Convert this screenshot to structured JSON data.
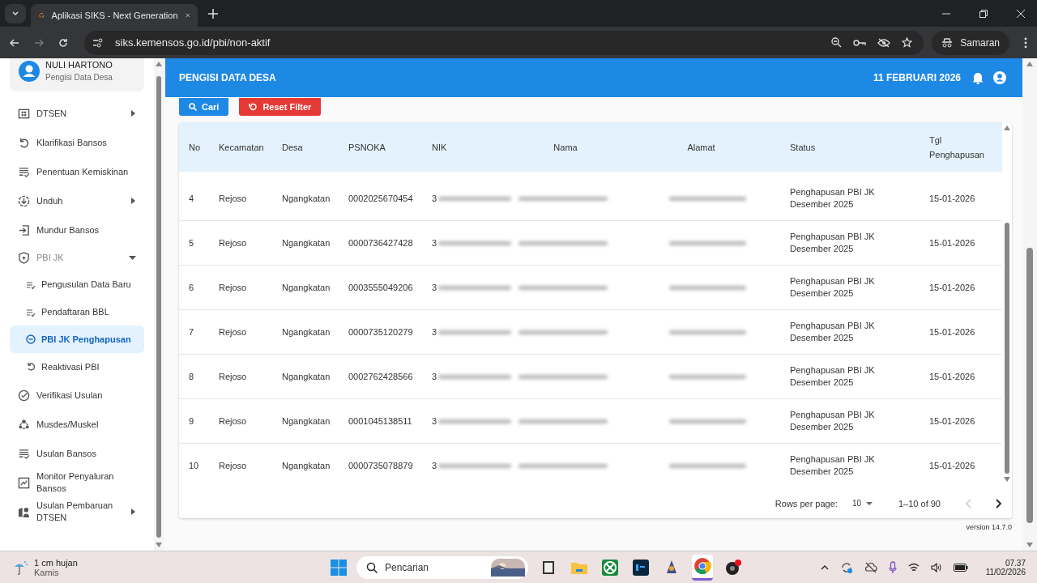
{
  "browser": {
    "tab_title": "Aplikasi SIKS - Next Generation",
    "url": "siks.kemensos.go.id/pbi/non-aktif",
    "profile_label": "Samaran"
  },
  "header": {
    "title": "PENGISI DATA DESA",
    "date": "11 FEBRUARI 2026"
  },
  "user": {
    "name": "NULI HARTONO",
    "role": "Pengisi Data Desa"
  },
  "sidebar": {
    "items": [
      {
        "label": "DTSEN",
        "expanded": false,
        "selected": false
      },
      {
        "label": "Klarifikasi Bansos",
        "selected": false
      },
      {
        "label": "Penentuan Kemiskinan",
        "selected": false
      },
      {
        "label": "Unduh",
        "expanded": false,
        "selected": false
      },
      {
        "label": "Mundur Bansos",
        "selected": false
      },
      {
        "label": "PBI JK",
        "expanded": true,
        "selected": false,
        "children": [
          {
            "label": "Pengusulan Data Baru",
            "selected": false
          },
          {
            "label": "Pendaftaran BBL",
            "selected": false
          },
          {
            "label": "PBI JK Penghapusan",
            "selected": true
          },
          {
            "label": "Reaktivasi PBI",
            "selected": false
          }
        ]
      },
      {
        "label": "Verifikasi Usulan",
        "selected": false
      },
      {
        "label": "Musdes/Muskel",
        "selected": false
      },
      {
        "label": "Usulan Bansos",
        "selected": false
      },
      {
        "label": "Monitor Penyaluran Bansos",
        "selected": false
      },
      {
        "label": "Usulan Pembaruan DTSEN",
        "expanded": false,
        "selected": false
      }
    ]
  },
  "filter_buttons": [
    {
      "label": "Cari",
      "kind": "search"
    },
    {
      "label": "Reset Filter",
      "kind": "reset"
    }
  ],
  "table": {
    "columns": [
      "No",
      "Kecamatan",
      "Desa",
      "PSNOKA",
      "NIK",
      "Nama",
      "Alamat",
      "Status",
      "Tgl Penghapusan"
    ],
    "rows": [
      {
        "no": "4",
        "kecamatan": "Rejoso",
        "desa": "Ngangkatan",
        "psnoka": "0002025670454",
        "nik": "3",
        "status": "Penghapusan PBI JK Desember 2025",
        "tgl": "15-01-2026"
      },
      {
        "no": "5",
        "kecamatan": "Rejoso",
        "desa": "Ngangkatan",
        "psnoka": "0000736427428",
        "nik": "3",
        "status": "Penghapusan PBI JK Desember 2025",
        "tgl": "15-01-2026"
      },
      {
        "no": "6",
        "kecamatan": "Rejoso",
        "desa": "Ngangkatan",
        "psnoka": "0003555049206",
        "nik": "3",
        "status": "Penghapusan PBI JK Desember 2025",
        "tgl": "15-01-2026"
      },
      {
        "no": "7",
        "kecamatan": "Rejoso",
        "desa": "Ngangkatan",
        "psnoka": "0000735120279",
        "nik": "3",
        "status": "Penghapusan PBI JK Desember 2025",
        "tgl": "15-01-2026"
      },
      {
        "no": "8",
        "kecamatan": "Rejoso",
        "desa": "Ngangkatan",
        "psnoka": "0002762428566",
        "nik": "3",
        "status": "Penghapusan PBI JK Desember 2025",
        "tgl": "15-01-2026"
      },
      {
        "no": "9",
        "kecamatan": "Rejoso",
        "desa": "Ngangkatan",
        "psnoka": "0001045138511",
        "nik": "3",
        "status": "Penghapusan PBI JK Desember 2025",
        "tgl": "15-01-2026"
      },
      {
        "no": "10",
        "kecamatan": "Rejoso",
        "desa": "Ngangkatan",
        "psnoka": "0000735078879",
        "nik": "3",
        "status": "Penghapusan PBI JK Desember 2025",
        "tgl": "15-01-2026"
      }
    ]
  },
  "pagination": {
    "rows_label": "Rows per page:",
    "rows_value": "10",
    "range": "1–10 of 90",
    "prev_disabled": true
  },
  "version": "version 14.7.0",
  "taskbar": {
    "weather": "1 cm hujan",
    "day": "Kamis",
    "search_placeholder": "Pencarian",
    "apps": [
      {
        "kind": "files",
        "active": false
      },
      {
        "kind": "folder",
        "active": false
      },
      {
        "kind": "xbox",
        "active": false
      },
      {
        "kind": "ps",
        "active": false
      },
      {
        "kind": "game",
        "active": false
      },
      {
        "kind": "chrome",
        "active": true
      },
      {
        "kind": "obs",
        "active": false
      }
    ],
    "time": "07.37",
    "date": "11/02/2026"
  }
}
